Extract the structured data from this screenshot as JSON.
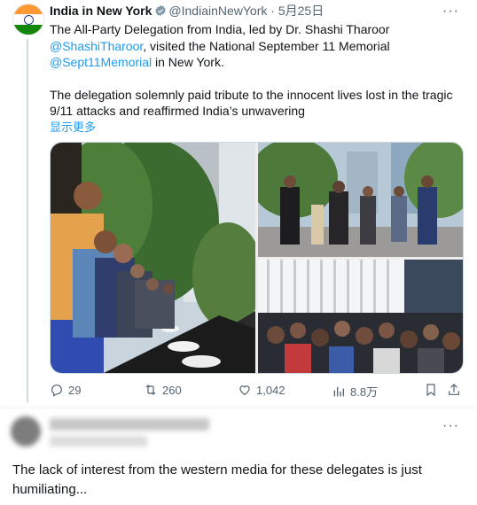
{
  "tweet": {
    "author_name": "India in New York",
    "handle": "@IndiainNewYork",
    "separator": "·",
    "date": "5月25日",
    "text_prefix": "The All-Party Delegation from India, led by Dr. Shashi Tharoor",
    "mention1": "@ShashiTharoor",
    "text_mid": ", visited the National September 11 Memorial",
    "mention2": "@Sept11Memorial",
    "text_suffix": " in New York.",
    "paragraph2": "The delegation solemnly paid tribute to the innocent lives lost in the tragic 9/11 attacks and reaffirmed India’s unwavering",
    "show_more": "显示更多",
    "stats": {
      "replies": "29",
      "retweets": "260",
      "likes": "1,042",
      "views": "8.8万"
    },
    "flag_colors": [
      "#ff9933",
      "#ffffff",
      "#138808"
    ],
    "icons": [
      "verified-badge-icon",
      "more-icon",
      "reply-icon",
      "retweet-icon",
      "like-icon",
      "views-icon",
      "bookmark-icon",
      "share-icon"
    ]
  },
  "reply": {
    "text": "The lack of interest from the western media for these delegates is just humiliating..."
  }
}
